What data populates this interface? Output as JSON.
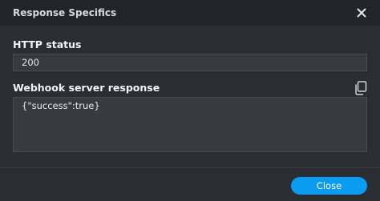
{
  "dialog": {
    "title": "Response Specifics",
    "close_icon": "close-icon"
  },
  "fields": {
    "http_status_label": "HTTP status",
    "http_status_value": "200",
    "response_label": "Webhook server response",
    "response_value": "{\"success\":true}",
    "copy_icon": "copy-icon"
  },
  "footer": {
    "close_label": "Close"
  },
  "colors": {
    "accent": "#0a9cf0",
    "background": "#2a2e33",
    "titlebar": "#212428",
    "field": "#373b40"
  }
}
